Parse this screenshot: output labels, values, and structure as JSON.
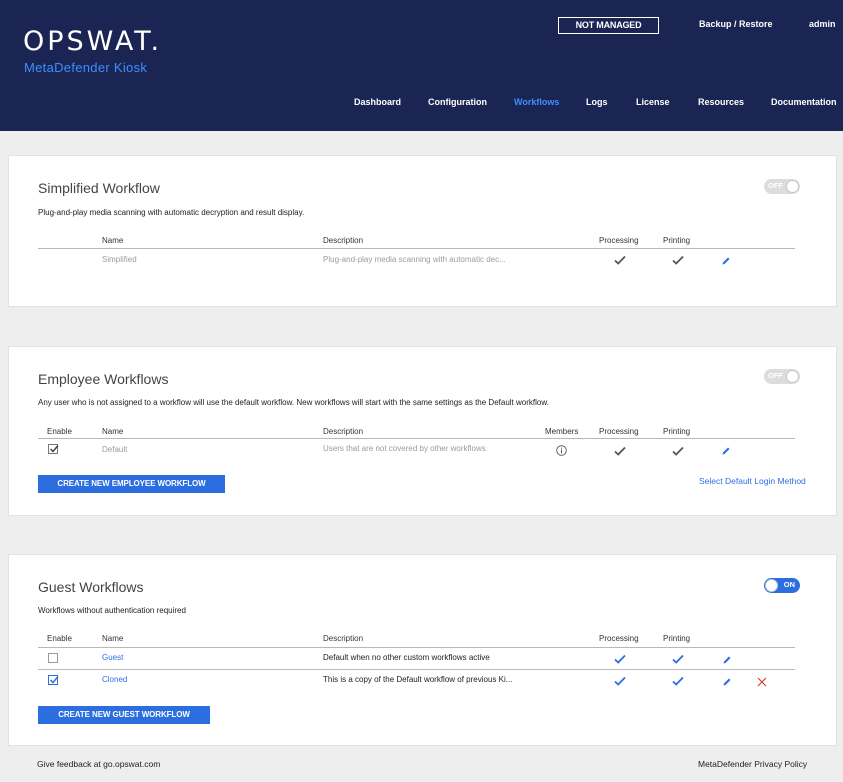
{
  "header": {
    "logo": "OPSWAT.",
    "product": "MetaDefender Kiosk",
    "badge": "NOT MANAGED",
    "backup_restore": "Backup / Restore",
    "user": "admin",
    "nav": [
      "Dashboard",
      "Configuration",
      "Workflows",
      "Logs",
      "License",
      "Resources",
      "Documentation"
    ],
    "active_nav": "Workflows"
  },
  "simplified": {
    "title": "Simplified Workflow",
    "description": "Plug-and-play media scanning with automatic decryption and result display.",
    "toggle": "OFF",
    "columns": {
      "name": "Name",
      "description": "Description",
      "processing": "Processing",
      "printing": "Printing"
    },
    "rows": [
      {
        "name": "Simplified",
        "description": "Plug-and-play media scanning with automatic dec..."
      }
    ]
  },
  "employee": {
    "title": "Employee Workflows",
    "description": "Any user who is not assigned to a workflow will use the default workflow. New workflows will start with the same settings as the Default workflow.",
    "toggle": "OFF",
    "columns": {
      "enable": "Enable",
      "name": "Name",
      "description": "Description",
      "members": "Members",
      "processing": "Processing",
      "printing": "Printing"
    },
    "rows": [
      {
        "name": "Default",
        "description": "Users that are not covered by other workflows",
        "enabled": true
      }
    ],
    "create_button": "CREATE NEW EMPLOYEE WORKFLOW",
    "login_method_link": "Select Default Login Method"
  },
  "guest": {
    "title": "Guest Workflows",
    "description": "Workflows without authentication required",
    "toggle": "ON",
    "columns": {
      "enable": "Enable",
      "name": "Name",
      "description": "Description",
      "processing": "Processing",
      "printing": "Printing"
    },
    "rows": [
      {
        "name": "Guest",
        "description": "Default when no other custom workflows active",
        "enabled": false
      },
      {
        "name": "Cloned",
        "description": "This is a copy of the Default workflow of previous Ki...",
        "enabled": true
      }
    ],
    "create_button": "CREATE NEW GUEST WORKFLOW"
  },
  "footer": {
    "feedback": "Give feedback at go.opswat.com",
    "privacy": "MetaDefender Privacy Policy"
  },
  "colors": {
    "header_bg": "#1b2553",
    "accent": "#2c6ee0",
    "active_nav": "#3d8eff",
    "check_grey": "#555555"
  },
  "icons": {
    "check": "check-icon",
    "edit": "pencil-icon",
    "info": "info-icon",
    "delete": "close-icon"
  }
}
